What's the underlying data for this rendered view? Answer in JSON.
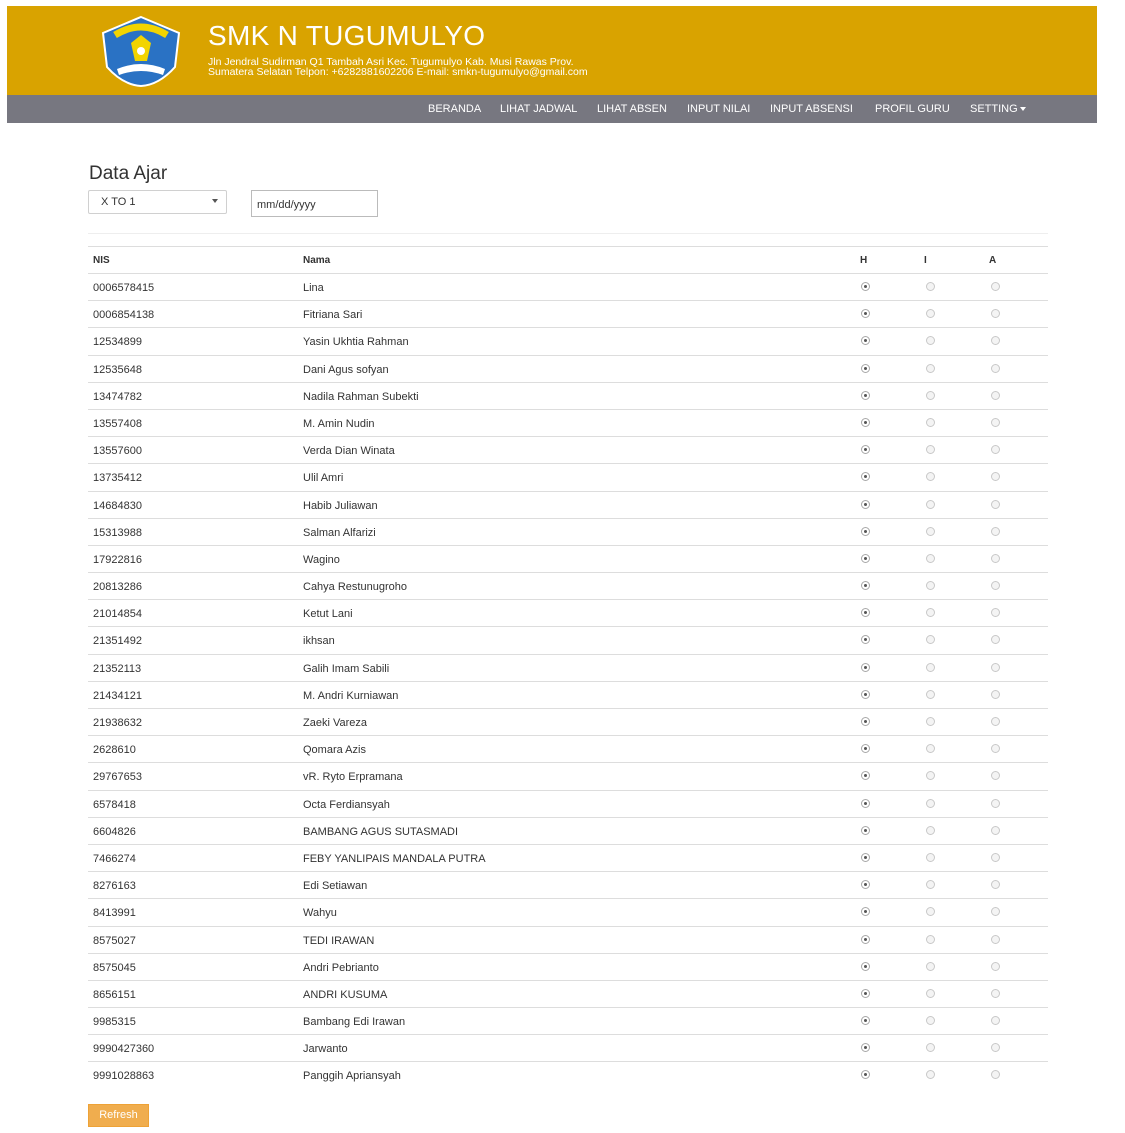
{
  "header": {
    "title": "SMK N TUGUMULYO",
    "address_line1": "Jln Jendral Sudirman Q1 Tambah Asri Kec. Tugumulyo Kab. Musi Rawas Prov.",
    "address_line2": "Sumatera Selatan Telpon: +6282881602206 E-mail: smkn-tugumulyo@gmail.com",
    "logo_text": "TUT WURI HANDAYANI",
    "color": "#d9a300"
  },
  "nav": {
    "items": [
      "BERANDA",
      "LIHAT JADWAL",
      "LIHAT ABSEN",
      "INPUT NILAI",
      "INPUT ABSENSI",
      "PROFIL GURU"
    ],
    "setting": "SETTING",
    "color": "#777780"
  },
  "main": {
    "title": "Data Ajar",
    "class_select": "X TO 1",
    "date_placeholder": "mm/dd/yyyy",
    "refresh_label": "Refresh",
    "refresh_color": "#f0ad4e"
  },
  "table": {
    "headers": {
      "nis": "NIS",
      "nama": "Nama",
      "h": "H",
      "i": "I",
      "a": "A"
    },
    "rows": [
      {
        "nis": "0006578415",
        "nama": "Lina",
        "status": "H"
      },
      {
        "nis": "0006854138",
        "nama": "Fitriana Sari",
        "status": "H"
      },
      {
        "nis": "12534899",
        "nama": "Yasin Ukhtia Rahman",
        "status": "H"
      },
      {
        "nis": "12535648",
        "nama": "Dani Agus sofyan",
        "status": "H"
      },
      {
        "nis": "13474782",
        "nama": "Nadila Rahman Subekti",
        "status": "H"
      },
      {
        "nis": "13557408",
        "nama": "M. Amin Nudin",
        "status": "H"
      },
      {
        "nis": "13557600",
        "nama": "Verda Dian Winata",
        "status": "H"
      },
      {
        "nis": "13735412",
        "nama": "Ulil Amri",
        "status": "H"
      },
      {
        "nis": "14684830",
        "nama": "Habib Juliawan",
        "status": "H"
      },
      {
        "nis": "15313988",
        "nama": "Salman Alfarizi",
        "status": "H"
      },
      {
        "nis": "17922816",
        "nama": "Wagino",
        "status": "H"
      },
      {
        "nis": "20813286",
        "nama": "Cahya Restunugroho",
        "status": "H"
      },
      {
        "nis": "21014854",
        "nama": "Ketut Lani",
        "status": "H"
      },
      {
        "nis": "21351492",
        "nama": "ikhsan",
        "status": "H"
      },
      {
        "nis": "21352113",
        "nama": "Galih Imam Sabili",
        "status": "H"
      },
      {
        "nis": "21434121",
        "nama": "M. Andri Kurniawan",
        "status": "H"
      },
      {
        "nis": "21938632",
        "nama": "Zaeki Vareza",
        "status": "H"
      },
      {
        "nis": "2628610",
        "nama": "Qomara Azis",
        "status": "H"
      },
      {
        "nis": "29767653",
        "nama": "vR. Ryto Erpramana",
        "status": "H"
      },
      {
        "nis": "6578418",
        "nama": "Octa Ferdiansyah",
        "status": "H"
      },
      {
        "nis": "6604826",
        "nama": "BAMBANG AGUS SUTASMADI",
        "status": "H"
      },
      {
        "nis": "7466274",
        "nama": "FEBY YANLIPAIS MANDALA PUTRA",
        "status": "H"
      },
      {
        "nis": "8276163",
        "nama": "Edi Setiawan",
        "status": "H"
      },
      {
        "nis": "8413991",
        "nama": "Wahyu",
        "status": "H"
      },
      {
        "nis": "8575027",
        "nama": "TEDI IRAWAN",
        "status": "H"
      },
      {
        "nis": "8575045",
        "nama": "Andri Pebrianto",
        "status": "H"
      },
      {
        "nis": "8656151",
        "nama": "ANDRI KUSUMA",
        "status": "H"
      },
      {
        "nis": "9985315",
        "nama": "Bambang Edi Irawan",
        "status": "H"
      },
      {
        "nis": "9990427360",
        "nama": "Jarwanto",
        "status": "H"
      },
      {
        "nis": "9991028863",
        "nama": "Panggih Apriansyah",
        "status": "H"
      }
    ]
  }
}
